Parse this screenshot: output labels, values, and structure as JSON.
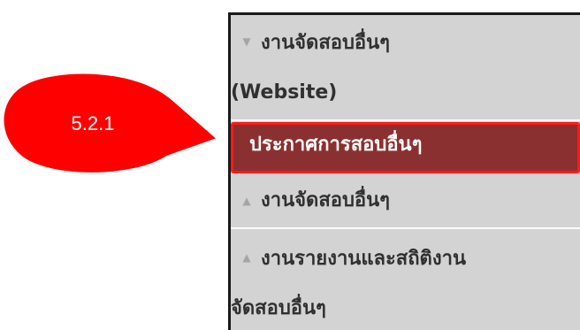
{
  "callout": {
    "label": "5.2.1",
    "fill_color": "#ff0000"
  },
  "menu": {
    "items": [
      {
        "line1": "งานจัดสอบอื่นๆ",
        "line2": "(Website)",
        "arrow": "expanded",
        "icon": "triangle-down-icon"
      },
      {
        "label": "ประกาศการสอบอื่นๆ",
        "selected": true
      },
      {
        "label": "งานจัดสอบอื่นๆ",
        "arrow": "collapsed",
        "icon": "triangle-up-icon"
      },
      {
        "line1": "งานรายงานและสถิติงาน",
        "line2": "จัดสอบอื่นๆ",
        "arrow": "collapsed",
        "icon": "triangle-up-icon"
      }
    ],
    "colors": {
      "background": "#d3d3d3",
      "selected_background": "#8b3030",
      "selected_border": "#ff1a1a",
      "text": "#303030"
    }
  }
}
